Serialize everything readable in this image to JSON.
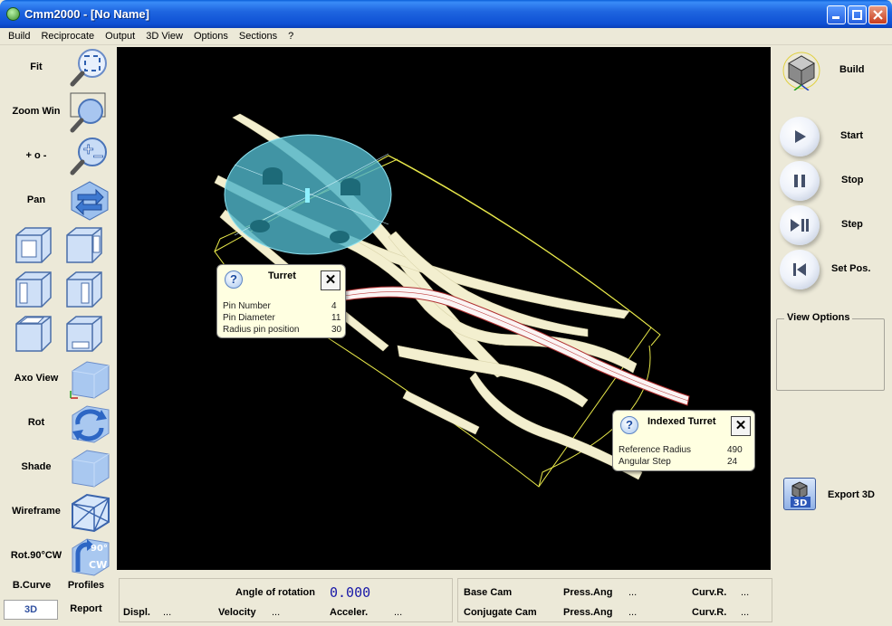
{
  "window": {
    "title": "Cmm2000 - [No Name]"
  },
  "menu": [
    "Build",
    "Reciprocate",
    "Output",
    "3D View",
    "Options",
    "Sections",
    "?"
  ],
  "left_tools": {
    "fit": "Fit",
    "zoom_win": "Zoom Win",
    "zoom_pm": "+ o -",
    "pan": "Pan",
    "axo_view": "Axo View",
    "rot": "Rot",
    "shade": "Shade",
    "wireframe": "Wireframe",
    "rot90": "Rot.90°CW",
    "rot90_icon_text_top": "90°",
    "rot90_icon_text_bottom": "CW"
  },
  "left_tabs": {
    "bcurve": "B.Curve",
    "profiles": "Profiles",
    "tab_3d": "3D",
    "report": "Report"
  },
  "right_panel": {
    "build": "Build",
    "start": "Start",
    "stop": "Stop",
    "step": "Step",
    "set_pos": "Set Pos.",
    "view_options": "View Options",
    "export_3d": "Export 3D",
    "export_icon_text": "3D"
  },
  "status": {
    "angle_label": "Angle of rotation",
    "angle_value": "0.000",
    "displ_label": "Displ.",
    "displ_value": "...",
    "velocity_label": "Velocity",
    "velocity_value": "...",
    "acceler_label": "Acceler.",
    "acceler_value": "...",
    "base_cam_label": "Base Cam",
    "base_press_label": "Press.Ang",
    "base_press_value": "...",
    "base_curv_label": "Curv.R.",
    "base_curv_value": "...",
    "conj_cam_label": "Conjugate Cam",
    "conj_press_label": "Press.Ang",
    "conj_press_value": "...",
    "conj_curv_label": "Curv.R.",
    "conj_curv_value": "..."
  },
  "popup_turret": {
    "help": "?",
    "title": "Turret",
    "close": "✕",
    "rows": [
      {
        "label": "Pin Number",
        "value": "4"
      },
      {
        "label": "Pin Diameter",
        "value": "11"
      },
      {
        "label": "Radius pin position",
        "value": "30"
      }
    ]
  },
  "popup_indexed": {
    "help": "?",
    "title": "Indexed Turret",
    "close": "✕",
    "rows": [
      {
        "label": "Reference Radius",
        "value": "490"
      },
      {
        "label": "Angular Step",
        "value": "24"
      }
    ]
  },
  "colors": {
    "titlebar": "#0e50d4",
    "viewport_bg": "#000000",
    "disc": "#4fb4c8",
    "cam_strip": "#f3efcf",
    "wire": "#e8e84a",
    "popup_bg": "#ffffe1",
    "angle_value": "#1a1aa8"
  }
}
